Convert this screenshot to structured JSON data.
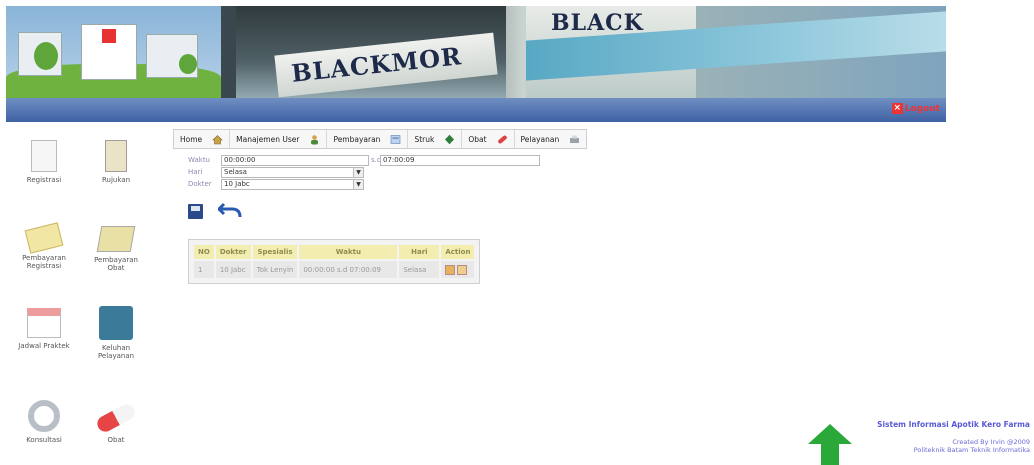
{
  "header": {
    "brand_top": "BLACK",
    "brand_left": "BLACKMOR",
    "logout_label": "Logout"
  },
  "sidebar": {
    "items": [
      {
        "label": "Registrasi",
        "icon": "document-icon"
      },
      {
        "label": "Rujukan",
        "icon": "clipboard-icon"
      },
      {
        "label": "Pembayaran\nRegistrasi",
        "icon": "card-icon"
      },
      {
        "label": "Pembayaran\nObat",
        "icon": "cash-icon"
      },
      {
        "label": "Jadwal Praktek",
        "icon": "calendar-icon"
      },
      {
        "label": "Keluhan\nPelayanan",
        "icon": "book-icon"
      },
      {
        "label": "Konsultasi",
        "icon": "gear-icon"
      },
      {
        "label": "Obat",
        "icon": "pill-icon"
      }
    ]
  },
  "menu": {
    "items": [
      {
        "label": "Home",
        "icon": "home-icon"
      },
      {
        "label": "Manajemen User",
        "icon": "user-icon"
      },
      {
        "label": "Pembayaran",
        "icon": "payment-icon"
      },
      {
        "label": "Struk",
        "icon": "receipt-icon"
      },
      {
        "label": "Obat",
        "icon": "pill-icon"
      },
      {
        "label": "Pelayanan",
        "icon": "service-icon"
      }
    ]
  },
  "form": {
    "waktu_label": "Waktu",
    "waktu_value": "00:00:00",
    "sd_label": "s.d",
    "sd_value": "07:00:09",
    "hari_label": "Hari",
    "hari_value": "Selasa",
    "dokter_label": "Dokter",
    "dokter_value": "10 Jabc"
  },
  "table": {
    "headers": [
      "NO",
      "Dokter",
      "Spesialis",
      "Waktu",
      "Hari",
      "Action"
    ],
    "rows": [
      [
        "1",
        "10 Jabc",
        "Tok Lenyin",
        "00:00:00 s.d 07:00:09",
        "Selasa",
        ""
      ]
    ]
  },
  "footer": {
    "title": "Sistem Informasi Apotik Kero Farma",
    "credit": "Created By Irvin @2009",
    "institution": "Politeknik Batam Teknik Informatika"
  },
  "colors": {
    "header_bar": "#4a6cae",
    "logout": "#e33333",
    "table_header": "#f3eeb0",
    "footer_text": "#5a5ad6",
    "arrow": "#2aa83a"
  }
}
